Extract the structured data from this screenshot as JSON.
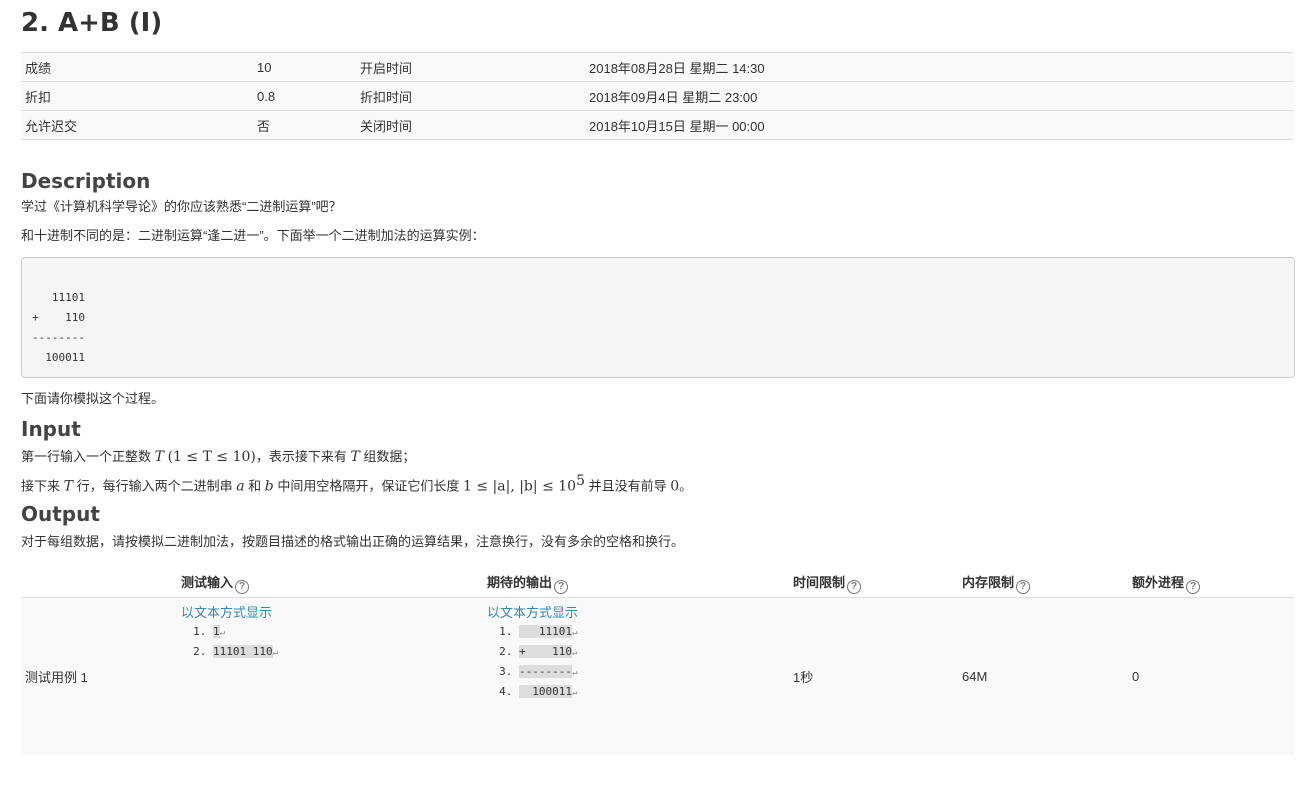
{
  "problem": {
    "title": "2. A+B (I)"
  },
  "info": [
    {
      "k1": "成绩",
      "v1": "10",
      "k2": "开启时间",
      "v2": "2018年08月28日 星期二 14:30"
    },
    {
      "k1": "折扣",
      "v1": "0.8",
      "k2": "折扣时间",
      "v2": "2018年09月4日 星期二 23:00"
    },
    {
      "k1": "允许迟交",
      "v1": "否",
      "k2": "关闭时间",
      "v2": "2018年10月15日 星期一 00:00"
    }
  ],
  "description": {
    "heading": "Description",
    "p1": "学过《计算机科学导论》的你应该熟悉“二进制运算”吧？",
    "p2": "和十进制不同的是：二进制运算“逢二进一”。下面举一个二进制加法的运算实例：",
    "code": "   11101\n+    110\n--------\n  100011",
    "p3": "下面请你模拟这个过程。"
  },
  "input": {
    "heading": "Input",
    "l1_a": "第一行输入一个正整数 ",
    "l1_T": "T",
    "l1_cond": "(1 ≤ T ≤ 10)",
    "l1_b": "，表示接下来有 ",
    "l1_T2": "T",
    "l1_c": " 组数据；",
    "l2_a": "接下来 ",
    "l2_T": "T",
    "l2_b": " 行，每行输入两个二进制串 ",
    "l2_var_a": "a",
    "l2_and": " 和 ",
    "l2_var_b": "b",
    "l2_c": " 中间用空格隔开，保证它们长度 ",
    "l2_cond": "1 ≤ |a|, |b| ≤ 10",
    "l2_exp": "5",
    "l2_d": " 并且没有前导 ",
    "l2_zero": "0",
    "l2_e": "。"
  },
  "output": {
    "heading": "Output",
    "p": "对于每组数据，请按模拟二进制加法，按题目描述的格式输出正确的运算结果，注意换行，没有多余的空格和换行。"
  },
  "cases": {
    "headers": {
      "input": "测试输入",
      "expected": "期待的输出",
      "time": "时间限制",
      "memory": "内存限制",
      "extra": "额外进程"
    },
    "help_glyph": "?",
    "return_glyph": "↵",
    "rows": [
      {
        "name": "测试用例 1",
        "show_text": "以文本方式显示",
        "input_lines": [
          "1",
          "11101 110"
        ],
        "output_lines": [
          "   11101",
          "+    110",
          "--------",
          "  100011"
        ],
        "time": "1秒",
        "memory": "64M",
        "extra": "0"
      }
    ]
  }
}
